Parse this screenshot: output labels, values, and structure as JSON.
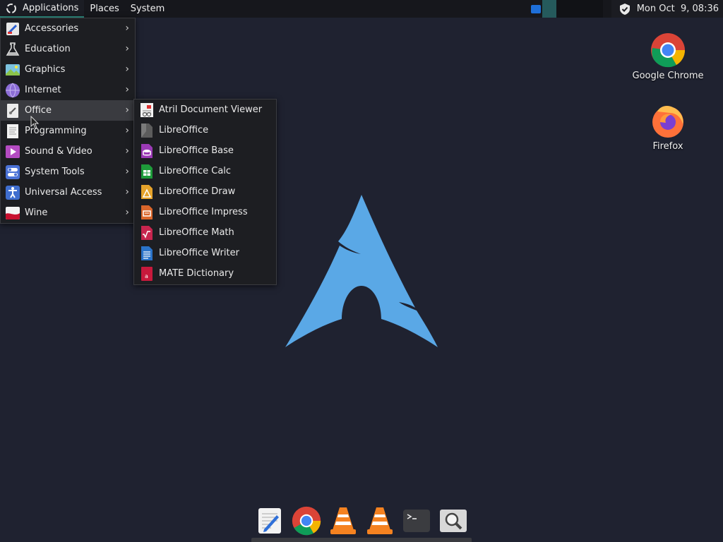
{
  "top_panel": {
    "menus": [
      {
        "label": "Applications"
      },
      {
        "label": "Places"
      },
      {
        "label": "System"
      }
    ],
    "clock": "Mon Oct  9, 08:36"
  },
  "desktop": {
    "icons": [
      {
        "label": "Google Chrome",
        "icon": "chrome-icon"
      },
      {
        "label": "Firefox",
        "icon": "firefox-icon"
      }
    ],
    "background_color": "#1f2230",
    "logo_color": "#5aa8e6"
  },
  "app_menu": {
    "items": [
      {
        "label": "Accessories",
        "icon": "accessories-icon"
      },
      {
        "label": "Education",
        "icon": "flask-icon"
      },
      {
        "label": "Graphics",
        "icon": "image-icon"
      },
      {
        "label": "Internet",
        "icon": "globe-icon"
      },
      {
        "label": "Office",
        "icon": "office-icon",
        "selected": true
      },
      {
        "label": "Programming",
        "icon": "document-icon"
      },
      {
        "label": "Sound & Video",
        "icon": "play-icon"
      },
      {
        "label": "System Tools",
        "icon": "toggle-icon"
      },
      {
        "label": "Universal Access",
        "icon": "accessibility-icon"
      },
      {
        "label": "Wine",
        "icon": "wine-icon"
      }
    ]
  },
  "office_menu": {
    "items": [
      {
        "label": "Atril Document Viewer",
        "icon": "atril-icon"
      },
      {
        "label": "LibreOffice",
        "icon": "libreoffice-icon"
      },
      {
        "label": "LibreOffice Base",
        "icon": "lo-base-icon"
      },
      {
        "label": "LibreOffice Calc",
        "icon": "lo-calc-icon"
      },
      {
        "label": "LibreOffice Draw",
        "icon": "lo-draw-icon"
      },
      {
        "label": "LibreOffice Impress",
        "icon": "lo-impress-icon"
      },
      {
        "label": "LibreOffice Math",
        "icon": "lo-math-icon"
      },
      {
        "label": "LibreOffice Writer",
        "icon": "lo-writer-icon"
      },
      {
        "label": "MATE Dictionary",
        "icon": "dictionary-icon"
      }
    ]
  },
  "dock": {
    "items": [
      {
        "icon": "text-editor-icon"
      },
      {
        "icon": "chrome-icon"
      },
      {
        "icon": "vlc-icon"
      },
      {
        "icon": "vlc-icon"
      },
      {
        "icon": "terminal-icon"
      },
      {
        "icon": "search-icon"
      }
    ]
  }
}
